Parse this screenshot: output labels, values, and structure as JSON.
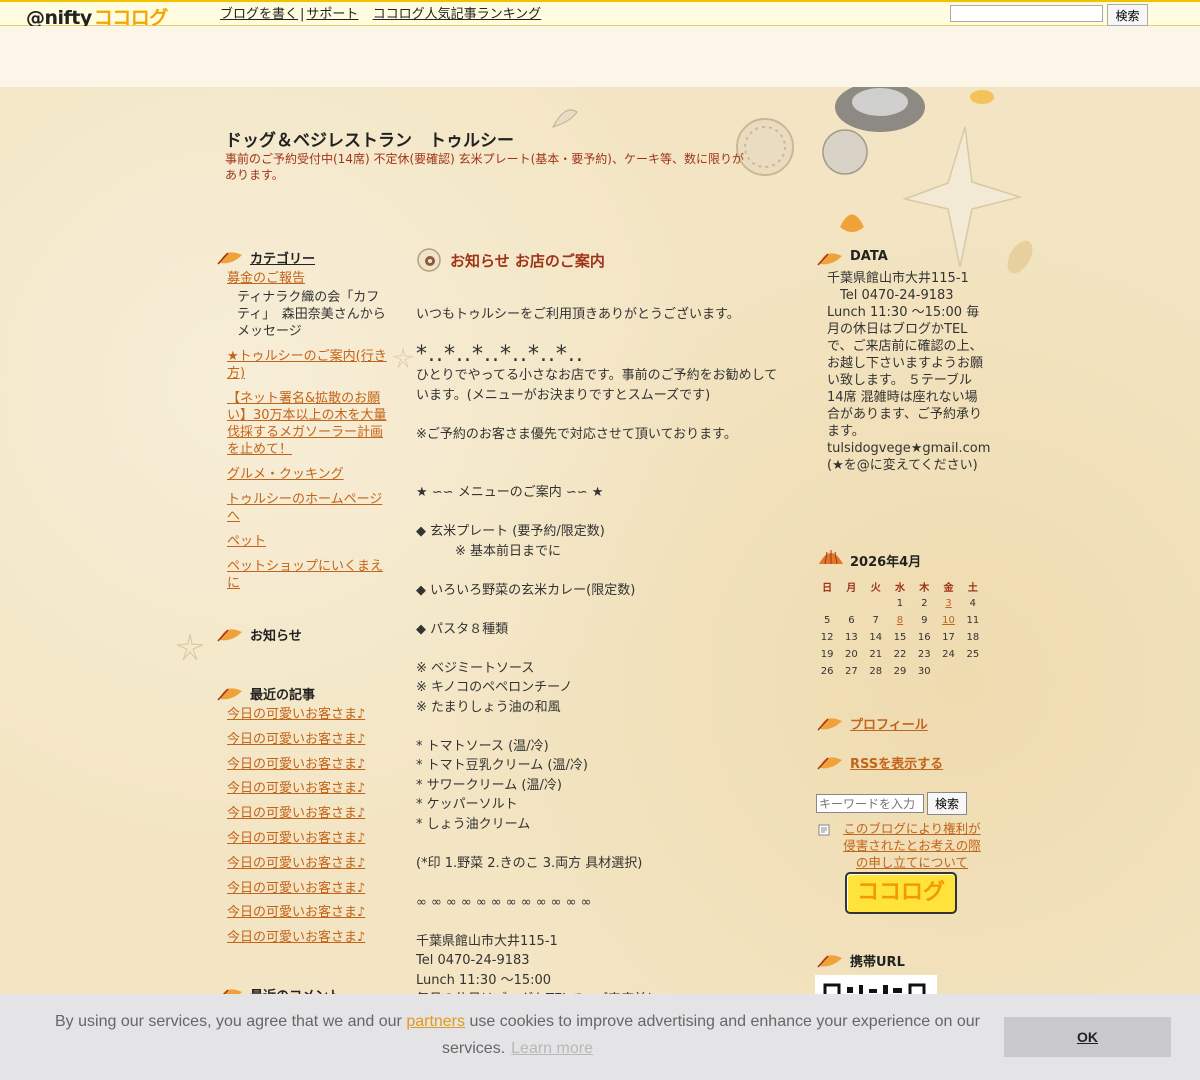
{
  "topbar": {
    "logo_prefix": "@nifty",
    "logo_brand": "ココログ",
    "nav": [
      "ブログを書く",
      "サポート",
      "ココログ人気記事ランキング"
    ],
    "nav_sep": "|",
    "search_value": "",
    "search_button": "検索"
  },
  "header": {
    "title": "ドッグ＆ベジレストラン　トゥルシー",
    "description": "事前のご予約受付中(14席) 不定休(要確認) 玄米プレート(基本・要予約)、ケーキ等、数に限りがあります。"
  },
  "left": {
    "category_title": "カテゴリー",
    "categories": [
      "募金のご報告",
      "★トゥルシーのご案内(行き方)",
      "【ネット署名&拡散のお願い】30万本以上の木を大量伐採するメガソーラー計画を止めて！",
      "グルメ・クッキング",
      "トゥルシーのホームページへ",
      "ペット",
      "ペットショップにいくまえに"
    ],
    "category_note": "ティナラク織の会「カフティ」　森田奈美さんからメッセージ",
    "notice_title": "お知らせ",
    "recent_title": "最近の記事",
    "recent_posts": [
      "今日の可愛いお客さま♪",
      "今日の可愛いお客さま♪",
      "今日の可愛いお客さま♪",
      "今日の可愛いお客さま♪",
      "今日の可愛いお客さま♪",
      "今日の可愛いお客さま♪",
      "今日の可愛いお客さま♪",
      "今日の可愛いお客さま♪",
      "今日の可愛いお客さま♪",
      "今日の可愛いお客さま♪"
    ],
    "comments_title": "最近のコメント"
  },
  "post": {
    "title": "お知らせ お店のご案内",
    "lines": [
      "いつもトゥルシーをご利用頂きありがとうございます。",
      "",
      "*..*..*..*..*..*..",
      "ひとりでやってる小さなお店です。事前のご予約をお勧めしています。(メニューがお決まりですとスムーズです)",
      "",
      "※ご予約のお客さま優先で対応させて頂いております。",
      "",
      "",
      "★ ∽∽ メニューのご案内 ∽∽ ★",
      "",
      "◆ 玄米プレート (要予約/限定数)",
      "　　　※ 基本前日までに",
      "",
      "◆ いろいろ野菜の玄米カレー(限定数)",
      "",
      "◆ パスタ８種類",
      "",
      "※ ベジミートソース",
      "※ キノコのペペロンチーノ",
      "※ たまりしょう油の和風",
      "",
      "* トマトソース (温/冷)",
      "* トマト豆乳クリーム (温/冷)",
      "* サワークリーム (温/冷)",
      "* ケッパーソルト",
      "* しょう油クリーム",
      "",
      "(*印 1.野菜 2.きのこ 3.両方 具材選択)",
      "",
      "∞ ∞ ∞ ∞ ∞ ∞ ∞ ∞ ∞ ∞ ∞ ∞",
      "",
      "千葉県館山市大井115-1",
      "Tel 0470-24-9183",
      "Lunch 11:30 〜15:00",
      "毎月の休日はブログかTELで、ご来店前に"
    ]
  },
  "right": {
    "data_title": "DATA",
    "data_lines": [
      "千葉県館山市大井115-1",
      "　Tel 0470-24-9183",
      "Lunch 11:30 〜15:00 毎月の休日はブログかTELで、ご来店前に確認の上、お越し下さいますようお願い致します。 ５テーブル14席 混雑時は座れない場合があります、ご予約承ります。",
      "tulsidogvege★gmail.com",
      "(★を@に変えてください)"
    ],
    "calendar_title": "2026年4月",
    "weekdays": [
      "日",
      "月",
      "火",
      "水",
      "木",
      "金",
      "土"
    ],
    "calendar_rows": [
      [
        "",
        "",
        "",
        "1",
        "2",
        "3",
        "4"
      ],
      [
        "5",
        "6",
        "7",
        "8",
        "9",
        "10",
        "11"
      ],
      [
        "12",
        "13",
        "14",
        "15",
        "16",
        "17",
        "18"
      ],
      [
        "19",
        "20",
        "21",
        "22",
        "23",
        "24",
        "25"
      ],
      [
        "26",
        "27",
        "28",
        "29",
        "30",
        "",
        ""
      ]
    ],
    "calendar_links": [
      "3",
      "8",
      "10"
    ],
    "profile_link": "プロフィール",
    "rss_link": "RSSを表示する",
    "keyword_placeholder": "キーワードを入力",
    "keyword_button": "検索",
    "rights_link": "このブログにより権利が侵害されたとお考えの際の申し立てについて",
    "badge_text": "ココログ",
    "mobile_title": "携帯URL"
  },
  "cookie": {
    "text_before": "By using our services, you agree that we and our ",
    "partners_link": "partners",
    "text_after": " use cookies to improve advertising and enhance your experience on our services.",
    "learn_more": "Learn more",
    "ok_button": "OK"
  },
  "colors": {
    "accent_orange": "#c2641a",
    "title_red": "#a0341a",
    "topbar_yellow": "#f2c200"
  }
}
